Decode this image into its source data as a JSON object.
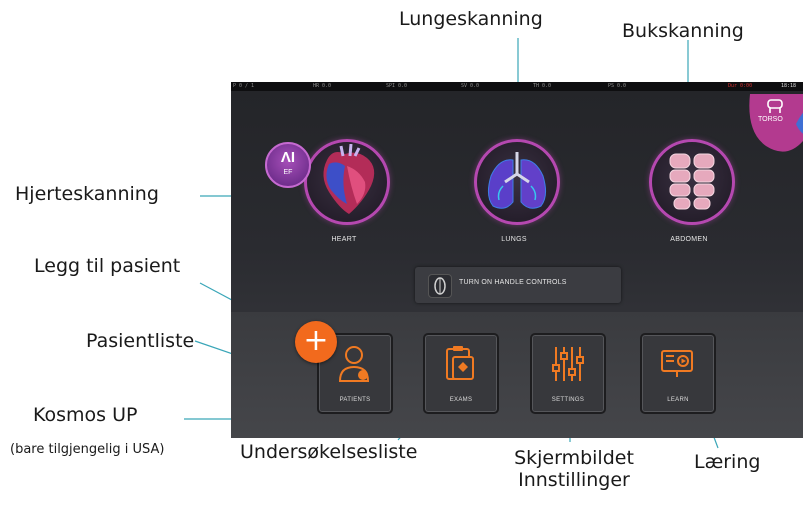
{
  "callouts": {
    "lung_scan": "Lungeskanning",
    "abdomen_scan": "Bukskanning",
    "heart_scan": "Hjerteskanning",
    "add_patient": "Legg til pasient",
    "patient_list": "Pasientliste",
    "kosmos_up": "Kosmos UP",
    "kosmos_up_note": "(bare tilgjengelig i USA)",
    "exam_list": "Undersøkelsesliste",
    "settings_screen_line1": "Skjermbildet",
    "settings_screen_line2": "Innstillinger",
    "learning": "Læring"
  },
  "device": {
    "status_bar": {
      "time": "18:18",
      "readouts": [
        "P 0 / 1",
        "HR 0.0",
        "SPI 0.0",
        "SV 0.0",
        "TH 0.0",
        "PS 0.0",
        "Dur 0:00"
      ]
    },
    "torso_tab": {
      "label": "TORSO",
      "icon": "torso-icon"
    },
    "ef_badge": {
      "top": "ΛI",
      "bottom": "EF"
    },
    "exams": [
      {
        "label": "HEART",
        "icon": "heart-icon"
      },
      {
        "label": "LUNGS",
        "icon": "lungs-icon"
      },
      {
        "label": "ABDOMEN",
        "icon": "abdomen-icon"
      }
    ],
    "handle_controls": {
      "label": "TURN ON HANDLE CONTROLS"
    },
    "add_button": {
      "label": "+"
    },
    "tiles": [
      {
        "label": "PATIENTS",
        "icon": "patient-icon"
      },
      {
        "label": "EXAMS",
        "icon": "exam-clipboard-icon"
      },
      {
        "label": "SETTINGS",
        "icon": "sliders-icon"
      },
      {
        "label": "LEARN",
        "icon": "learn-video-icon"
      }
    ],
    "accent_colors": {
      "exam_ring": "#b548b0",
      "tile_icon": "#f07a22",
      "add_button": "#f26a1d"
    }
  }
}
